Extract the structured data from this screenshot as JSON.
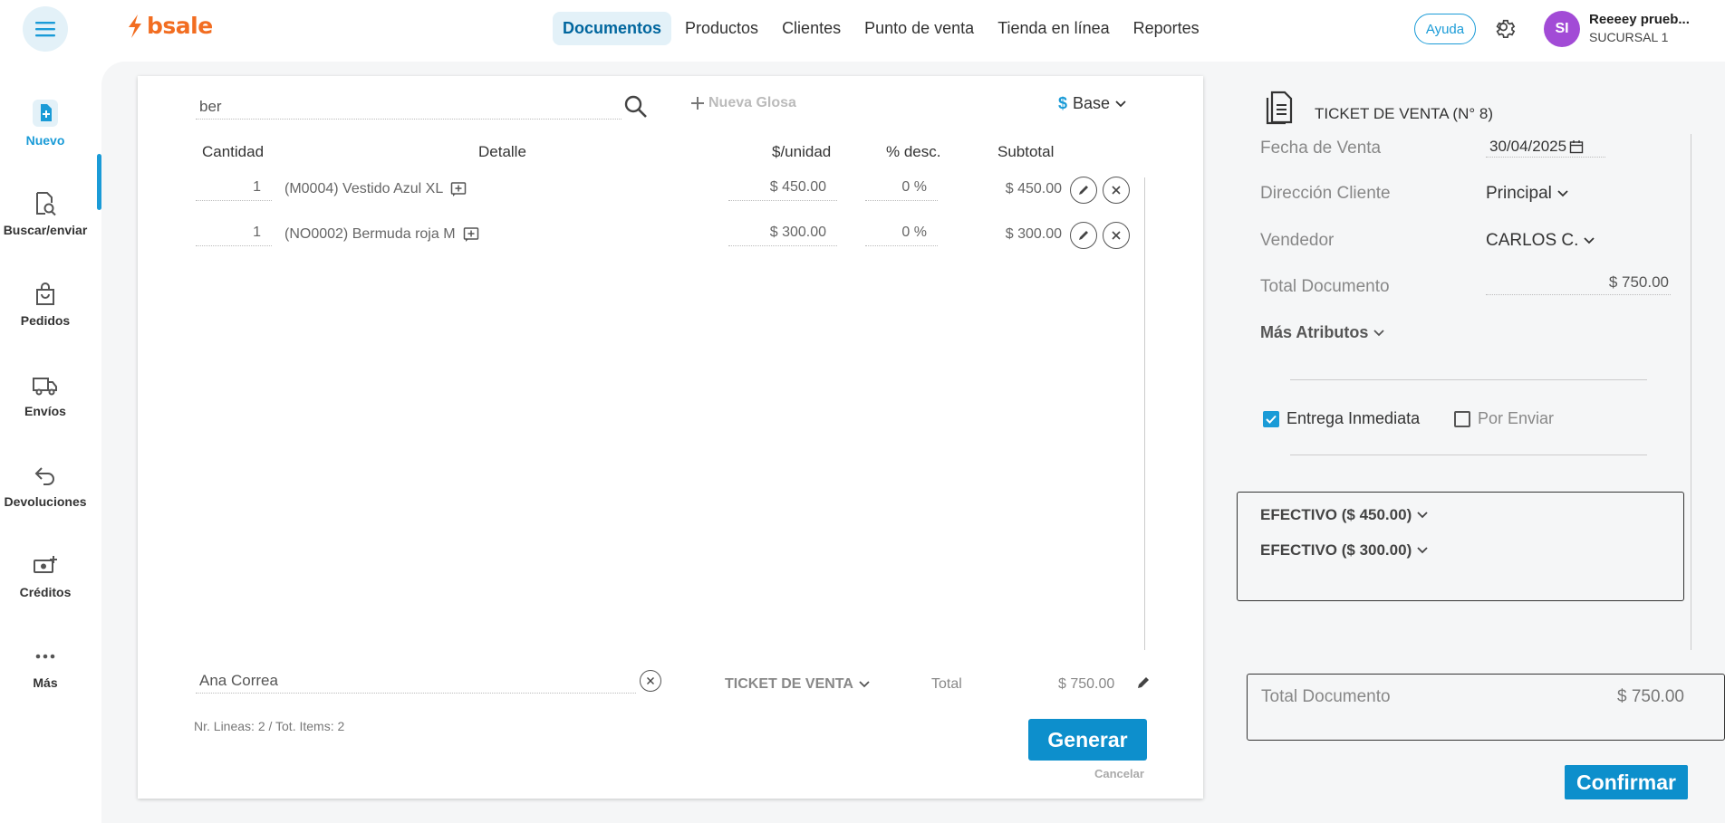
{
  "header": {
    "logo_text": "bsale",
    "nav": [
      "Documentos",
      "Productos",
      "Clientes",
      "Punto de venta",
      "Tienda en línea",
      "Reportes"
    ],
    "active_nav": "Documentos",
    "help_label": "Ayuda",
    "user": {
      "initials": "SI",
      "name": "Reeeey prueb...",
      "branch": "SUCURSAL 1"
    }
  },
  "sidebar": {
    "items": [
      {
        "label": "Nuevo",
        "icon": "new-document-icon",
        "active": true
      },
      {
        "label": "Buscar/enviar",
        "icon": "search-document-icon",
        "active": false
      },
      {
        "label": "Pedidos",
        "icon": "shopping-bag-icon",
        "active": false
      },
      {
        "label": "Envíos",
        "icon": "truck-icon",
        "active": false
      },
      {
        "label": "Devoluciones",
        "icon": "return-arrow-icon",
        "active": false
      },
      {
        "label": "Créditos",
        "icon": "money-plus-icon",
        "active": false
      },
      {
        "label": "Más",
        "icon": "more-dots-icon",
        "active": false
      }
    ]
  },
  "document": {
    "search_value": "ber",
    "nueva_glosa": "Nueva Glosa",
    "price_list_symbol": "$",
    "price_list": "Base",
    "columns": {
      "cantidad": "Cantidad",
      "detalle": "Detalle",
      "unidad": "$/unidad",
      "desc": "% desc.",
      "subtotal": "Subtotal"
    },
    "lines": [
      {
        "qty": "1",
        "detail": "(M0004) Vestido Azul XL",
        "unit_price": "$ 450.00",
        "discount": "0 %",
        "subtotal": "$ 450.00"
      },
      {
        "qty": "1",
        "detail": "(NO0002) Bermuda roja M",
        "unit_price": "$ 300.00",
        "discount": "0 %",
        "subtotal": "$ 300.00"
      }
    ],
    "client": "Ana Correa",
    "doc_type": "TICKET DE VENTA",
    "total_label": "Total",
    "total_value": "$ 750.00",
    "lines_info": "Nr. Lineas: 2 / Tot. Items: 2",
    "generate_label": "Generar",
    "cancel_label": "Cancelar"
  },
  "right_panel": {
    "title": "TICKET DE VENTA (N° 8)",
    "fecha_label": "Fecha de Venta",
    "fecha_value": "30/04/2025",
    "direccion_label": "Dirección Cliente",
    "direccion_value": "Principal",
    "vendedor_label": "Vendedor",
    "vendedor_value": "CARLOS C.",
    "total_doc_label": "Total Documento",
    "total_doc_value": "$ 750.00",
    "mas_atributos": "Más Atributos",
    "entrega_inmediata": "Entrega Inmediata",
    "entrega_checked": true,
    "por_enviar": "Por Enviar",
    "por_enviar_checked": false,
    "payments": [
      "EFECTIVO ($ 450.00)",
      "EFECTIVO ($ 300.00)"
    ],
    "summary_label": "Total Documento",
    "summary_value": "$ 750.00",
    "confirm_label": "Confirmar"
  },
  "colors": {
    "accent": "#0d8fcc",
    "brand": "#f26d21",
    "avatar": "#a24bd6"
  }
}
